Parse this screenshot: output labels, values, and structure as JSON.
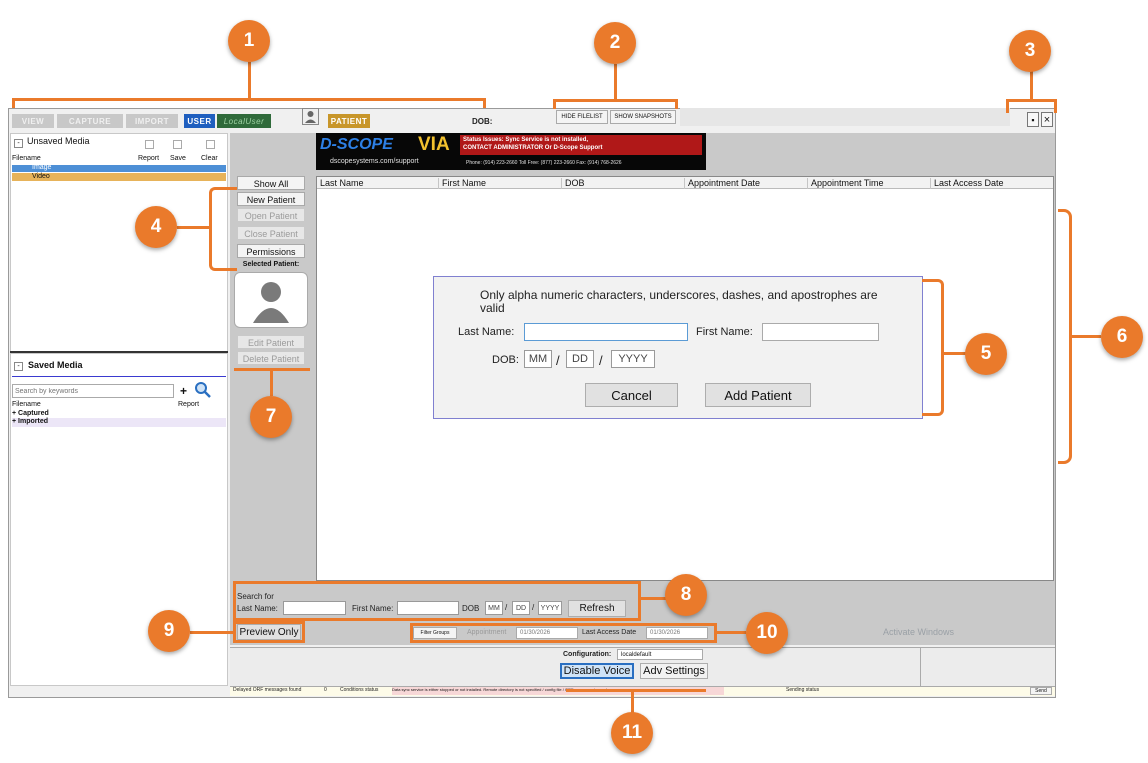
{
  "callouts": [
    "1",
    "2",
    "3",
    "4",
    "5",
    "6",
    "7",
    "8",
    "9",
    "10",
    "11"
  ],
  "top_tabs": {
    "view": "VIEW",
    "capture": "CAPTURE",
    "import": "IMPORT",
    "user": "USER",
    "user_name": "LocalUser",
    "patient": "PATIENT",
    "dob_label": "DOB:"
  },
  "file_tabs": {
    "hide_filelist": "HIDE FILELIST",
    "show_snapshots": "SHOW SNAPSHOTS"
  },
  "window": {
    "min_label": "▪",
    "close_label": "×"
  },
  "unsaved": {
    "title": "Unsaved Media",
    "col_filename": "Filename",
    "col_report": "Report",
    "col_save": "Save",
    "col_clear": "Clear",
    "items": [
      "Image",
      "Video"
    ]
  },
  "saved": {
    "title": "Saved Media",
    "search_placeholder": "Search by keywords",
    "col_filename": "Filename",
    "col_report": "Report",
    "items": [
      "Captured",
      "Imported"
    ]
  },
  "banner": {
    "logo": "D-SCOPE",
    "via": "VIA",
    "support": "dscopesystems.com/support",
    "status_line1": "Status Issues: Sync Service is not installed,",
    "status_line2": "CONTACT ADMINISTRATOR Or D-Scope Support",
    "phones": "Phone: (914) 223-2660  Toll Free: (877) 223-2660  Fax: (914) 768-2626"
  },
  "side_buttons": {
    "show_all": "Show All",
    "new_patient": "New Patient",
    "open_patient": "Open Patient",
    "close_patient": "Close Patient",
    "permissions": "Permissions",
    "selected_patient": "Selected Patient:",
    "edit_patient": "Edit Patient",
    "delete_patient": "Delete Patient"
  },
  "table": {
    "columns": [
      "Last Name",
      "First Name",
      "DOB",
      "Appointment Date",
      "Appointment Time",
      "Last Access Date"
    ]
  },
  "dialog": {
    "note": "Only alpha numeric characters, underscores, dashes, and apostrophes are valid",
    "last_name": "Last Name:",
    "first_name": "First Name:",
    "dob": "DOB:",
    "mm": "MM",
    "dd": "DD",
    "yyyy": "YYYY",
    "slash": "/",
    "cancel": "Cancel",
    "add_patient": "Add Patient"
  },
  "search": {
    "title": "Search for",
    "last_name": "Last Name:",
    "first_name": "First Name:",
    "dob": "DOB",
    "mm": "MM",
    "dd": "DD",
    "yyyy": "YYYY",
    "refresh": "Refresh"
  },
  "preview_only": "Preview Only",
  "filter": {
    "groups": "Filter Groups",
    "appointment": "Appointment",
    "appointment_date": "01/30/2026",
    "last_access": "Last Access Date",
    "last_access_date": "01/30/2026"
  },
  "watermark": "Activate Windows",
  "config": {
    "label": "Configuration:",
    "value": "localdefault"
  },
  "bottom_buttons": {
    "disable_voice": "Disable Voice",
    "adv_settings": "Adv Settings"
  },
  "status_bar": {
    "delayed": "Delayed ORF messages found",
    "delayed_count": "0",
    "conditions": "Conditions status",
    "conditions_msg": "Data sync service is either stopped or not installed. Remote directory is not specified / config file / ORF messages to send.",
    "sending": "Sending status",
    "send": "Send"
  }
}
